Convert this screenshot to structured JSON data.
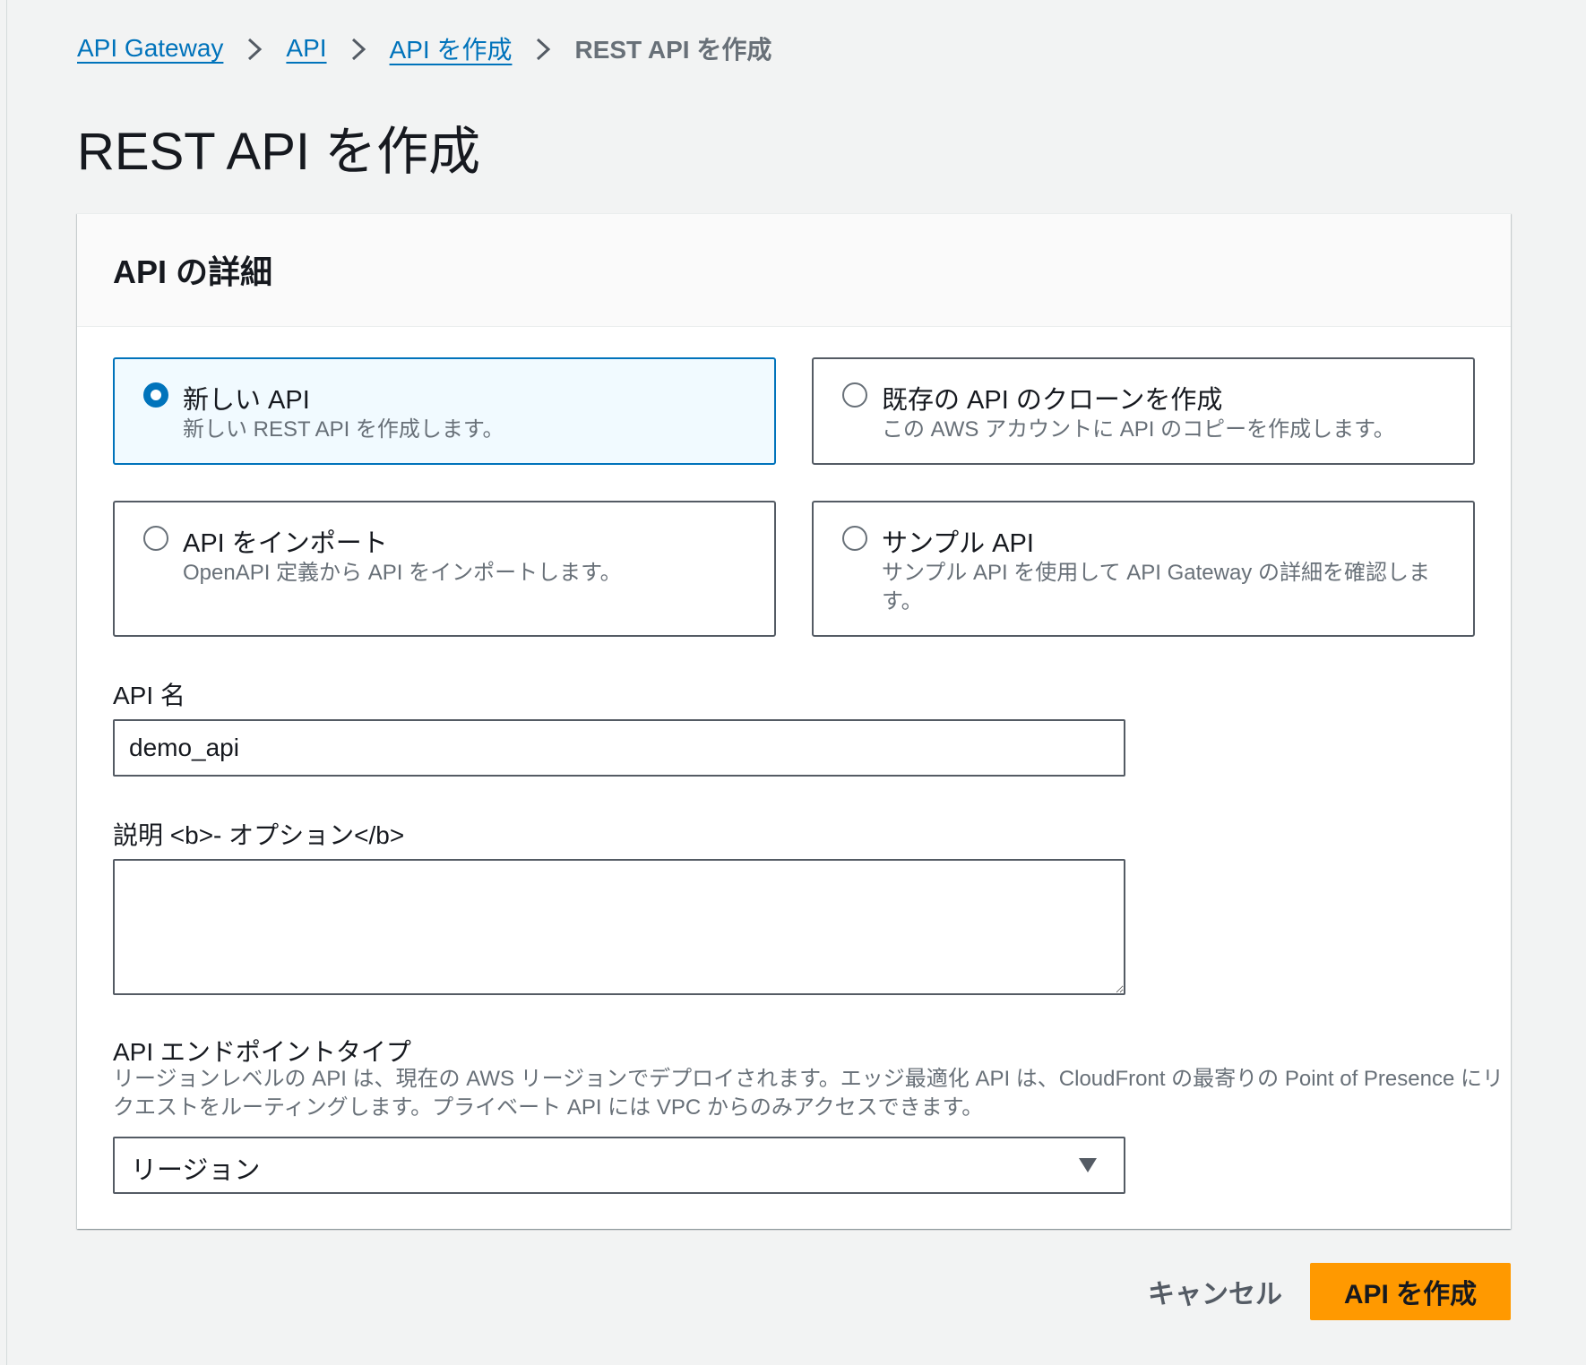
{
  "breadcrumb": {
    "items": [
      "API Gateway",
      "API",
      "API を作成"
    ],
    "current": "REST API を作成"
  },
  "page": {
    "title": "REST API を作成"
  },
  "panel": {
    "title": "API の詳細"
  },
  "options": [
    {
      "label": "新しい API",
      "description": "新しい REST API を作成します。",
      "selected": true
    },
    {
      "label": "既存の API のクローンを作成",
      "description": "この AWS アカウントに API のコピーを作成します。",
      "selected": false
    },
    {
      "label": "API をインポート",
      "description": "OpenAPI 定義から API をインポートします。",
      "selected": false
    },
    {
      "label": "サンプル API",
      "description": "サンプル API を使用して API Gateway の詳細を確認します。",
      "selected": false
    }
  ],
  "fields": {
    "api_name": {
      "label": "API 名",
      "value": "demo_api"
    },
    "description": {
      "label": "説明 <b>- オプション</b>",
      "value": ""
    },
    "endpoint_type": {
      "label": "API エンドポイントタイプ",
      "help": "リージョンレベルの API は、現在の AWS リージョンでデプロイされます。エッジ最適化 API は、CloudFront の最寄りの Point of Presence にリクエストをルーティングします。プライベート API には VPC からのみアクセスできます。",
      "selected": "リージョン"
    }
  },
  "actions": {
    "cancel": "キャンセル",
    "create": "API を作成"
  },
  "colors": {
    "link": "#0073bb",
    "primary_button": "#ff9900",
    "selected_tile_bg": "#f1faff"
  }
}
